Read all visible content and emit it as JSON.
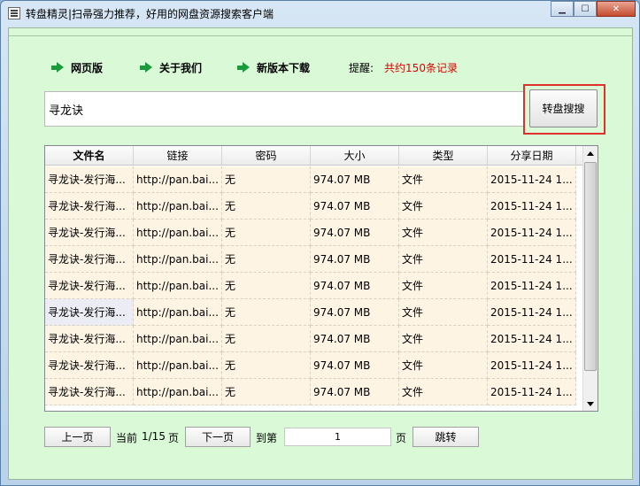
{
  "window": {
    "title": "转盘精灵|扫帚强力推荐，好用的网盘资源搜索客户端",
    "min_symbol": "▁",
    "max_symbol": "☐",
    "close_symbol": "✕"
  },
  "nav": {
    "items": [
      {
        "label": "网页版",
        "icon": "green-arrow-icon"
      },
      {
        "label": "关于我们",
        "icon": "green-arrow-icon"
      },
      {
        "label": "新版本下载",
        "icon": "green-arrow-icon"
      }
    ],
    "hint_label": "提醒:",
    "hint_text": "共约150条记录",
    "hint_color": "#e00000"
  },
  "search": {
    "value": "寻龙诀",
    "button_label": "转盘搜搜",
    "highlight_color": "#e0302c"
  },
  "table": {
    "columns": [
      "文件名",
      "链接",
      "密码",
      "大小",
      "类型",
      "分享日期"
    ],
    "rows": [
      [
        "寻龙诀-发行海...",
        "http://pan.bai...",
        "无",
        "974.07 MB",
        "文件",
        "2015-11-24 1..."
      ],
      [
        "寻龙诀-发行海...",
        "http://pan.bai...",
        "无",
        "974.07 MB",
        "文件",
        "2015-11-24 1..."
      ],
      [
        "寻龙诀-发行海...",
        "http://pan.bai...",
        "无",
        "974.07 MB",
        "文件",
        "2015-11-24 1..."
      ],
      [
        "寻龙诀-发行海...",
        "http://pan.bai...",
        "无",
        "974.07 MB",
        "文件",
        "2015-11-24 1..."
      ],
      [
        "寻龙诀-发行海...",
        "http://pan.bai...",
        "无",
        "974.07 MB",
        "文件",
        "2015-11-24 1..."
      ],
      [
        "寻龙诀-发行海...",
        "http://pan.bai...",
        "无",
        "974.07 MB",
        "文件",
        "2015-11-24 1..."
      ],
      [
        "寻龙诀-发行海...",
        "http://pan.bai...",
        "无",
        "974.07 MB",
        "文件",
        "2015-11-24 1..."
      ],
      [
        "寻龙诀-发行海...",
        "http://pan.bai...",
        "无",
        "974.07 MB",
        "文件",
        "2015-11-24 1..."
      ],
      [
        "寻龙诀-发行海...",
        "http://pan.bai...",
        "无",
        "974.07 MB",
        "文件",
        "2015-11-24 1..."
      ]
    ],
    "selected_row": 5
  },
  "pager": {
    "prev_label": "上一页",
    "current_prefix": "当前",
    "current_value": "1/15",
    "current_suffix": "页",
    "next_label": "下一页",
    "goto_prefix": "到第",
    "goto_value": "1",
    "goto_suffix": "页",
    "jump_label": "跳转"
  }
}
